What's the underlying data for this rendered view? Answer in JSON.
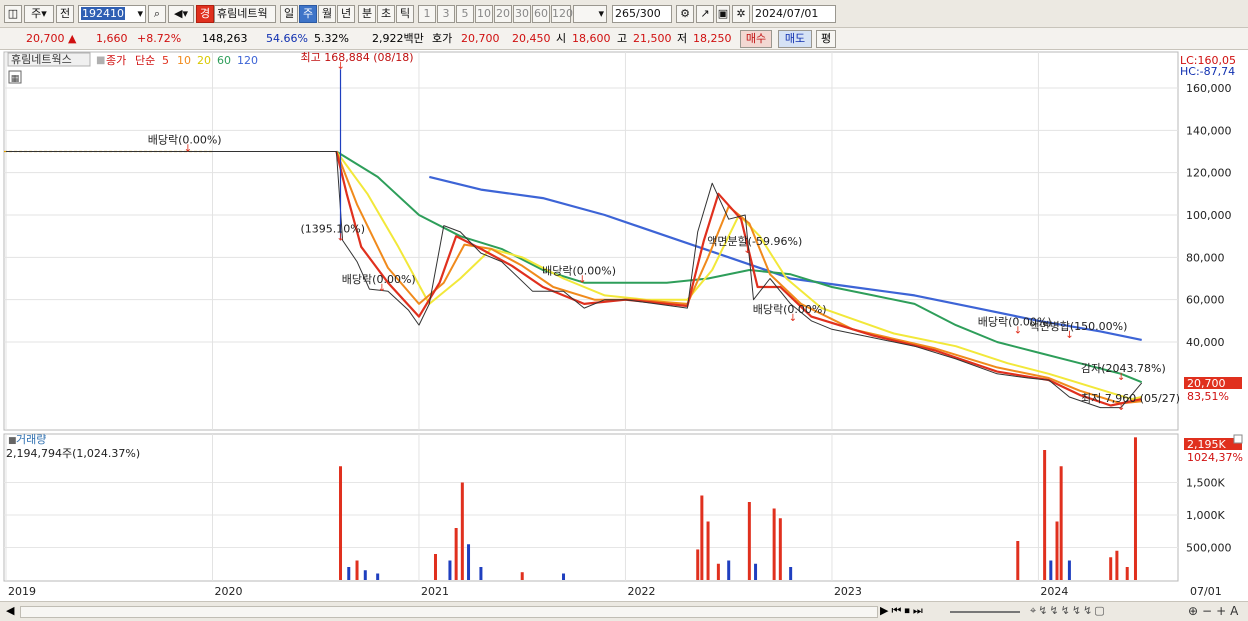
{
  "toolbar": {
    "type_label": "주",
    "prev_label": "전",
    "code": "192410",
    "stock_name_badge": "경",
    "stock_name": "휴림네트웍",
    "periods": [
      "일",
      "주",
      "월",
      "년",
      "분",
      "초",
      "틱"
    ],
    "selected_period": "주",
    "intervals": [
      "1",
      "3",
      "5",
      "10",
      "20",
      "30",
      "60",
      "120"
    ],
    "count": "265",
    "count_total": "/300",
    "date": "2024/07/01"
  },
  "quote": {
    "price": "20,700",
    "change": "1,660",
    "change_pct": "+8.72%",
    "volume": "148,263",
    "pct1": "54.66%",
    "pct2": "5.32%",
    "amount": "2,922백만",
    "ask_label": "호가",
    "ask1": "20,700",
    "ask2": "20,450",
    "open_label": "시",
    "open": "18,600",
    "high_label": "고",
    "high": "21,500",
    "low_label": "저",
    "low": "18,250",
    "buy_label": "매수",
    "sell_label": "매도",
    "eval_label": "평"
  },
  "colors": {
    "up": "#e0301e",
    "down": "#1f3fbf",
    "ma5": "#e0301e",
    "ma10": "#f08a1c",
    "ma20": "#f2e83a",
    "ma60": "#2e9e5a",
    "ma120": "#3d64d6"
  },
  "chart_data": {
    "type": "line",
    "legend": {
      "stock": "휴림네트웍스",
      "price_label": "종가",
      "ma_label": "단순",
      "ma_periods": [
        "5",
        "10",
        "20",
        "60",
        "120"
      ]
    },
    "x_ticks": [
      "2019",
      "2020",
      "2021",
      "2022",
      "2023",
      "2024",
      "07/01"
    ],
    "y_ticks": [
      "160,000",
      "140,000",
      "120,000",
      "100,000",
      "80,000",
      "60,000",
      "40,000"
    ],
    "ylim": [
      0,
      160000
    ],
    "lc_label": "LC:160,05",
    "hc_label": "HC:-87,74",
    "last_price_tag": "20,700",
    "last_pct_tag": "83,51%",
    "annotations": [
      {
        "text": "최고 168,884 (08/18)",
        "x": 2020.62,
        "y": 168884
      },
      {
        "text": "배당락(0.00%)",
        "x": 2019.88,
        "y": 130000
      },
      {
        "text": "(1395.10%)",
        "x": 2020.62,
        "y": 88000
      },
      {
        "text": "배당락(0.00%)",
        "x": 2020.82,
        "y": 64000
      },
      {
        "text": "배당락(0.00%)",
        "x": 2021.79,
        "y": 68000
      },
      {
        "text": "액면분할(-59.96%)",
        "x": 2022.59,
        "y": 82000
      },
      {
        "text": "배당락(0.00%)",
        "x": 2022.81,
        "y": 50000
      },
      {
        "text": "배당락(0.00%)",
        "x": 2023.9,
        "y": 44000
      },
      {
        "text": "액면병합(150.00%)",
        "x": 2024.15,
        "y": 42000
      },
      {
        "text": "감자(2043.78%)",
        "x": 2024.4,
        "y": 22000
      },
      {
        "text": "최저 7,960 (05/27)",
        "x": 2024.4,
        "y": 7960
      }
    ],
    "series": [
      {
        "name": "종가",
        "values": [
          [
            2019.0,
            130000
          ],
          [
            2019.5,
            130000
          ],
          [
            2020.0,
            130000
          ],
          [
            2020.6,
            130000
          ],
          [
            2020.63,
            88000
          ],
          [
            2020.7,
            78000
          ],
          [
            2020.76,
            65000
          ],
          [
            2020.85,
            64000
          ],
          [
            2020.95,
            55000
          ],
          [
            2021.0,
            48000
          ],
          [
            2021.05,
            58000
          ],
          [
            2021.12,
            95000
          ],
          [
            2021.2,
            92000
          ],
          [
            2021.3,
            82000
          ],
          [
            2021.4,
            78000
          ],
          [
            2021.55,
            64000
          ],
          [
            2021.7,
            64000
          ],
          [
            2021.8,
            56000
          ],
          [
            2021.9,
            60000
          ],
          [
            2022.0,
            60000
          ],
          [
            2022.15,
            58000
          ],
          [
            2022.3,
            56000
          ],
          [
            2022.35,
            92000
          ],
          [
            2022.42,
            115000
          ],
          [
            2022.5,
            98000
          ],
          [
            2022.58,
            100000
          ],
          [
            2022.62,
            60000
          ],
          [
            2022.7,
            70000
          ],
          [
            2022.8,
            58000
          ],
          [
            2022.9,
            50000
          ],
          [
            2023.0,
            46000
          ],
          [
            2023.2,
            42000
          ],
          [
            2023.4,
            38000
          ],
          [
            2023.6,
            32000
          ],
          [
            2023.8,
            25000
          ],
          [
            2023.95,
            23000
          ],
          [
            2024.05,
            22000
          ],
          [
            2024.15,
            14000
          ],
          [
            2024.3,
            9000
          ],
          [
            2024.4,
            9000
          ],
          [
            2024.5,
            20700
          ]
        ]
      },
      {
        "name": "5",
        "values": [
          [
            2020.6,
            130000
          ],
          [
            2020.65,
            110000
          ],
          [
            2020.72,
            85000
          ],
          [
            2020.85,
            68000
          ],
          [
            2021.0,
            52000
          ],
          [
            2021.1,
            68000
          ],
          [
            2021.18,
            90000
          ],
          [
            2021.3,
            84000
          ],
          [
            2021.45,
            76000
          ],
          [
            2021.6,
            66000
          ],
          [
            2021.8,
            58000
          ],
          [
            2022.0,
            60000
          ],
          [
            2022.3,
            57000
          ],
          [
            2022.38,
            88000
          ],
          [
            2022.45,
            110000
          ],
          [
            2022.56,
            98000
          ],
          [
            2022.64,
            66000
          ],
          [
            2022.75,
            66000
          ],
          [
            2022.9,
            52000
          ],
          [
            2023.2,
            43000
          ],
          [
            2023.5,
            36000
          ],
          [
            2023.8,
            26000
          ],
          [
            2024.05,
            22000
          ],
          [
            2024.2,
            15000
          ],
          [
            2024.35,
            10000
          ],
          [
            2024.5,
            13000
          ]
        ]
      },
      {
        "name": "10",
        "values": [
          [
            2020.6,
            130000
          ],
          [
            2020.7,
            105000
          ],
          [
            2020.85,
            75000
          ],
          [
            2021.0,
            58000
          ],
          [
            2021.12,
            68000
          ],
          [
            2021.22,
            86000
          ],
          [
            2021.35,
            84000
          ],
          [
            2021.5,
            76000
          ],
          [
            2021.65,
            66000
          ],
          [
            2021.85,
            60000
          ],
          [
            2022.05,
            60000
          ],
          [
            2022.3,
            58000
          ],
          [
            2022.4,
            80000
          ],
          [
            2022.5,
            104000
          ],
          [
            2022.6,
            96000
          ],
          [
            2022.7,
            72000
          ],
          [
            2022.85,
            58000
          ],
          [
            2023.1,
            46000
          ],
          [
            2023.5,
            37000
          ],
          [
            2023.8,
            28000
          ],
          [
            2024.05,
            23000
          ],
          [
            2024.2,
            17000
          ],
          [
            2024.4,
            11000
          ],
          [
            2024.5,
            12000
          ]
        ]
      },
      {
        "name": "20",
        "values": [
          [
            2020.6,
            130000
          ],
          [
            2020.75,
            110000
          ],
          [
            2020.9,
            85000
          ],
          [
            2021.05,
            58000
          ],
          [
            2021.2,
            70000
          ],
          [
            2021.35,
            84000
          ],
          [
            2021.5,
            80000
          ],
          [
            2021.7,
            70000
          ],
          [
            2021.9,
            62000
          ],
          [
            2022.1,
            60000
          ],
          [
            2022.3,
            60000
          ],
          [
            2022.42,
            74000
          ],
          [
            2022.55,
            100000
          ],
          [
            2022.65,
            90000
          ],
          [
            2022.78,
            70000
          ],
          [
            2022.95,
            56000
          ],
          [
            2023.3,
            44000
          ],
          [
            2023.6,
            38000
          ],
          [
            2023.85,
            30000
          ],
          [
            2024.05,
            25000
          ],
          [
            2024.25,
            19000
          ],
          [
            2024.45,
            13000
          ],
          [
            2024.5,
            14000
          ]
        ]
      },
      {
        "name": "60",
        "values": [
          [
            2020.6,
            130000
          ],
          [
            2020.8,
            118000
          ],
          [
            2021.0,
            100000
          ],
          [
            2021.2,
            90000
          ],
          [
            2021.4,
            84000
          ],
          [
            2021.6,
            74000
          ],
          [
            2021.8,
            68000
          ],
          [
            2022.0,
            68000
          ],
          [
            2022.2,
            68000
          ],
          [
            2022.4,
            70000
          ],
          [
            2022.6,
            74000
          ],
          [
            2022.8,
            72000
          ],
          [
            2023.0,
            66000
          ],
          [
            2023.2,
            62000
          ],
          [
            2023.4,
            58000
          ],
          [
            2023.6,
            48000
          ],
          [
            2023.8,
            40000
          ],
          [
            2024.0,
            35000
          ],
          [
            2024.2,
            30000
          ],
          [
            2024.4,
            25000
          ],
          [
            2024.5,
            21000
          ]
        ]
      },
      {
        "name": "120",
        "values": [
          [
            2021.05,
            118000
          ],
          [
            2021.3,
            112000
          ],
          [
            2021.6,
            108000
          ],
          [
            2021.9,
            100000
          ],
          [
            2022.2,
            90000
          ],
          [
            2022.5,
            80000
          ],
          [
            2022.8,
            70000
          ],
          [
            2023.1,
            66000
          ],
          [
            2023.4,
            62000
          ],
          [
            2023.7,
            56000
          ],
          [
            2024.0,
            50000
          ],
          [
            2024.3,
            45000
          ],
          [
            2024.5,
            41000
          ]
        ]
      }
    ],
    "volume": {
      "title": "거래량",
      "readout": "2,194,794주(1,024.37%)",
      "tag1": "2,195K",
      "tag2": "1024,37%",
      "y_ticks": [
        "1,500K",
        "1,000K",
        "500,000"
      ],
      "ylim": [
        0,
        2000000
      ],
      "bars": [
        [
          2020.62,
          1750000,
          "up"
        ],
        [
          2020.66,
          200000,
          "down"
        ],
        [
          2020.7,
          300000,
          "up"
        ],
        [
          2020.74,
          150000,
          "down"
        ],
        [
          2020.8,
          100000,
          "down"
        ],
        [
          2021.08,
          400000,
          "up"
        ],
        [
          2021.15,
          300000,
          "down"
        ],
        [
          2021.18,
          800000,
          "up"
        ],
        [
          2021.21,
          1500000,
          "up"
        ],
        [
          2021.24,
          550000,
          "down"
        ],
        [
          2021.3,
          200000,
          "down"
        ],
        [
          2021.5,
          120000,
          "up"
        ],
        [
          2021.7,
          100000,
          "down"
        ],
        [
          2022.35,
          470000,
          "up"
        ],
        [
          2022.37,
          1300000,
          "up"
        ],
        [
          2022.4,
          900000,
          "up"
        ],
        [
          2022.45,
          250000,
          "up"
        ],
        [
          2022.5,
          300000,
          "down"
        ],
        [
          2022.6,
          1200000,
          "up"
        ],
        [
          2022.63,
          250000,
          "down"
        ],
        [
          2022.72,
          1100000,
          "up"
        ],
        [
          2022.75,
          950000,
          "up"
        ],
        [
          2022.8,
          200000,
          "down"
        ],
        [
          2023.9,
          600000,
          "up"
        ],
        [
          2024.03,
          2000000,
          "up"
        ],
        [
          2024.06,
          300000,
          "down"
        ],
        [
          2024.09,
          900000,
          "up"
        ],
        [
          2024.11,
          1750000,
          "up"
        ],
        [
          2024.15,
          300000,
          "down"
        ],
        [
          2024.35,
          350000,
          "up"
        ],
        [
          2024.38,
          450000,
          "up"
        ],
        [
          2024.43,
          200000,
          "up"
        ],
        [
          2024.47,
          2195000,
          "up"
        ]
      ]
    }
  }
}
